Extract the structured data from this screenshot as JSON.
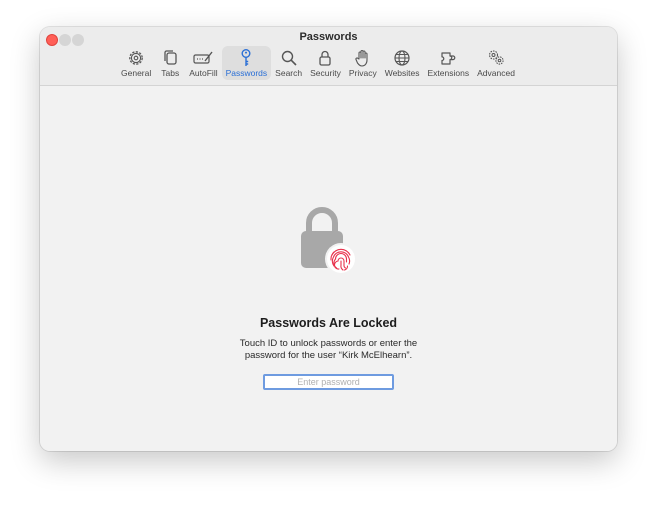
{
  "window": {
    "title": "Passwords"
  },
  "toolbar": {
    "items": [
      {
        "label": "General",
        "icon": "gear-icon"
      },
      {
        "label": "Tabs",
        "icon": "tabs-icon"
      },
      {
        "label": "AutoFill",
        "icon": "autofill-icon"
      },
      {
        "label": "Passwords",
        "icon": "key-icon",
        "active": true
      },
      {
        "label": "Search",
        "icon": "search-icon"
      },
      {
        "label": "Security",
        "icon": "lock-icon"
      },
      {
        "label": "Privacy",
        "icon": "hand-icon"
      },
      {
        "label": "Websites",
        "icon": "globe-icon"
      },
      {
        "label": "Extensions",
        "icon": "puzzle-icon"
      },
      {
        "label": "Advanced",
        "icon": "gears-icon"
      }
    ]
  },
  "locked": {
    "title": "Passwords Are Locked",
    "description": "Touch ID to unlock passwords or enter the password for the user “Kirk McElhearn”.",
    "placeholder": "Enter password"
  },
  "colors": {
    "accent": "#2a6fd6",
    "touchid": "#e8314c",
    "lock": "#a8a8a8"
  }
}
